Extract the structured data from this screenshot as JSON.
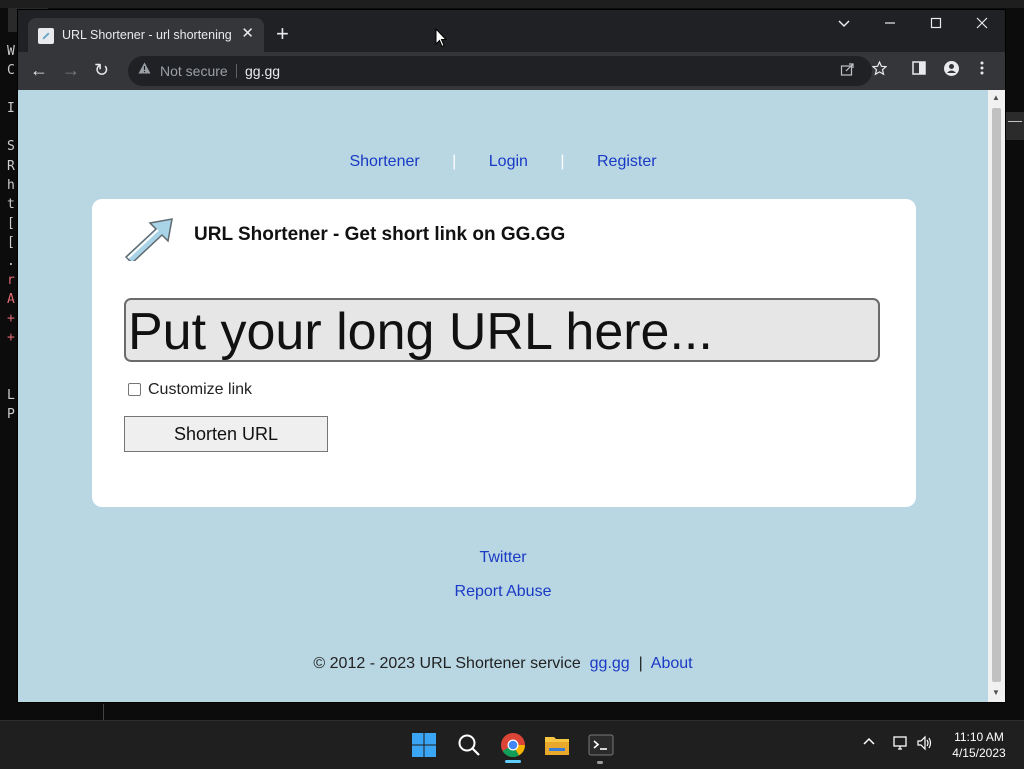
{
  "terminal": {
    "lines": [
      "W",
      "C",
      "",
      "I",
      "",
      "S",
      "R",
      "h",
      "t",
      "[",
      "[",
      ".",
      "r",
      "A",
      "+",
      "+",
      "",
      "",
      "L",
      "P"
    ]
  },
  "browser": {
    "tab_title": "URL Shortener - url shortening se",
    "tab_close": "✕",
    "new_tab": "+",
    "window_controls": {
      "dropdown": "⌵",
      "minimize": "—",
      "maximize": "☐",
      "close": "✕"
    },
    "nav": {
      "back": "←",
      "forward": "→",
      "reload": "↻"
    },
    "security_label": "Not secure",
    "url": "gg.gg",
    "icons": [
      "warning-icon",
      "share-icon",
      "star-icon",
      "sidepanel-icon",
      "profile-icon",
      "menu-icon"
    ]
  },
  "page": {
    "nav_links": [
      "Shortener",
      "Login",
      "Register"
    ],
    "nav_separator": "|",
    "title": "URL Shortener - Get short link on GG.GG",
    "input_placeholder": "Put your long URL here...",
    "customize_label": "Customize link",
    "shorten_button": "Shorten URL",
    "footer_links": [
      "Twitter",
      "Report Abuse"
    ],
    "copyright": "© 2012 - 2023 URL Shortener service",
    "copyright_links": [
      "gg.gg",
      "About"
    ],
    "copyright_separator": "|"
  },
  "taskbar": {
    "apps": [
      "windows-start-icon",
      "search-icon",
      "chrome-icon",
      "file-explorer-icon",
      "terminal-icon"
    ],
    "time": "11:10 AM",
    "date": "4/15/2023"
  },
  "colors": {
    "page_bg": "#b8d7e3",
    "link": "#1a39c4",
    "chrome_dark": "#202124",
    "chrome_toolbar": "#35363a"
  }
}
